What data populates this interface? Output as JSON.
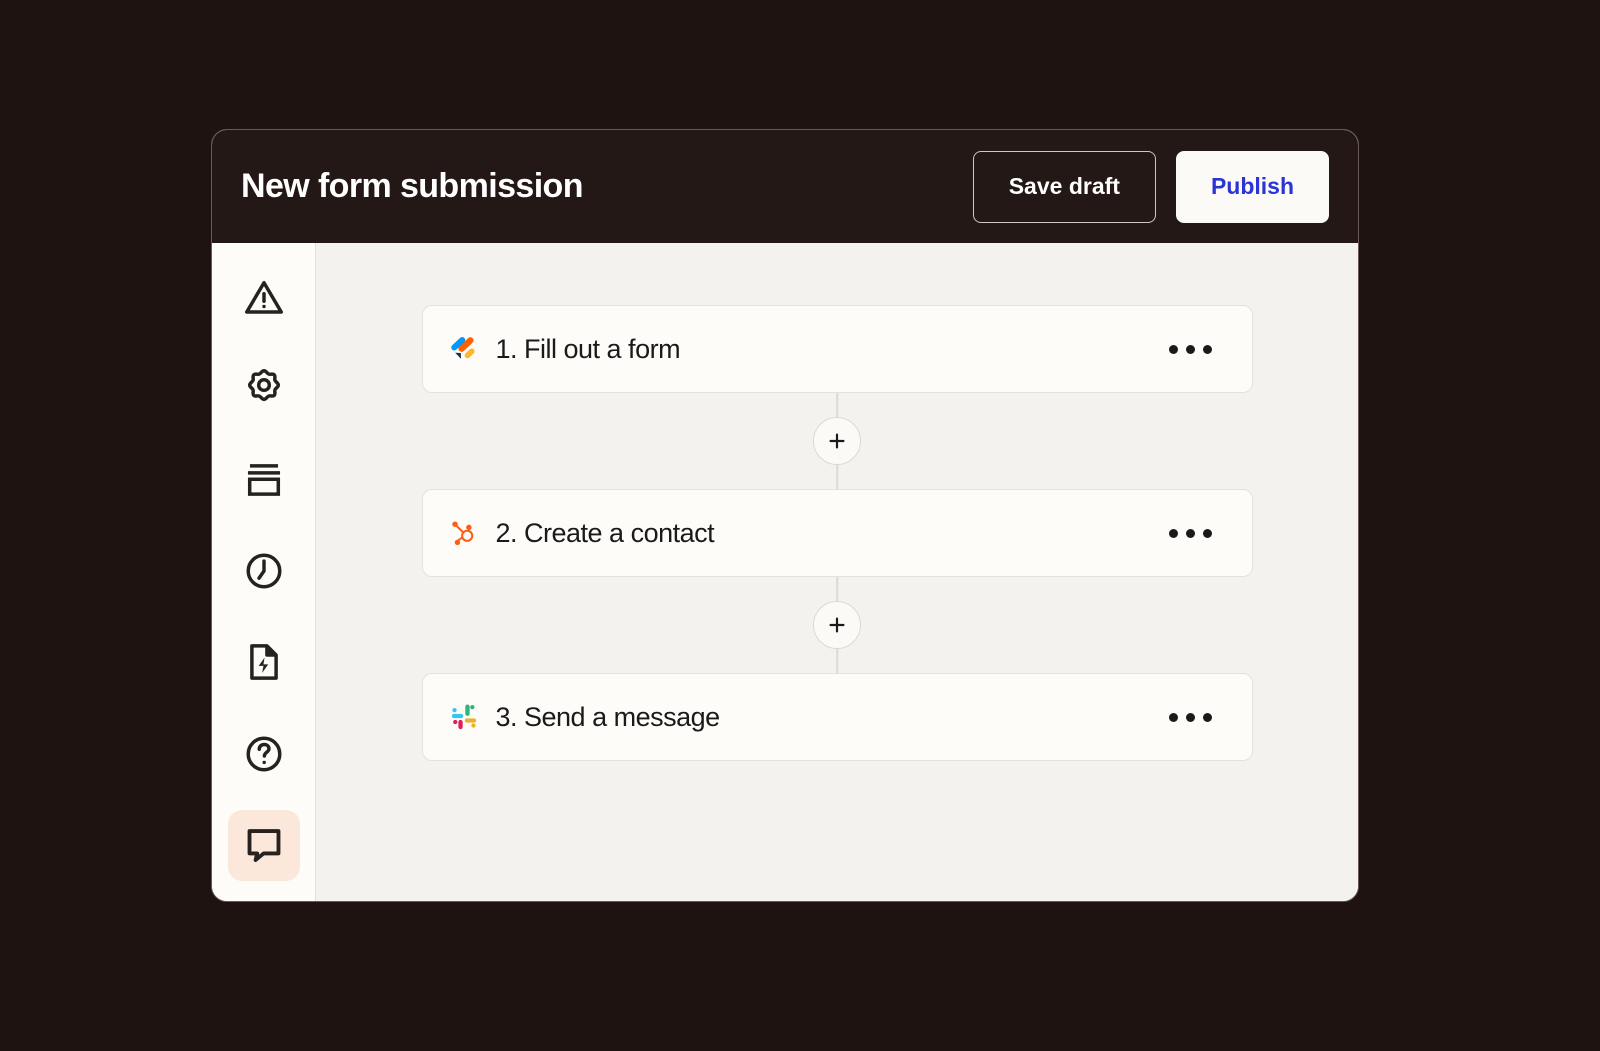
{
  "window": {
    "title": "New form submission",
    "background_color": "#1E1310",
    "header_color": "#231815",
    "canvas_color": "#F3F2EF",
    "sidebar_color": "#FDFCF8"
  },
  "header": {
    "title": "New form submission",
    "buttons": [
      {
        "label": "Save draft",
        "style": "secondary",
        "name": "save-draft-button"
      },
      {
        "label": "Publish",
        "style": "primary",
        "name": "publish-button",
        "text_color": "#2B35D6"
      }
    ]
  },
  "sidebar": {
    "items": [
      {
        "icon": "warning-triangle-icon",
        "active": false
      },
      {
        "icon": "gear-icon",
        "active": false
      },
      {
        "icon": "layers-icon",
        "active": false
      },
      {
        "icon": "clock-icon",
        "active": false
      },
      {
        "icon": "document-lightning-icon",
        "active": false
      },
      {
        "icon": "help-circle-icon",
        "active": false
      },
      {
        "icon": "comment-icon",
        "active": true
      }
    ],
    "active_highlight_color": "#FBE8DA"
  },
  "flow": {
    "steps": [
      {
        "label": "1. Fill out a form",
        "app": "jotform",
        "logo_colors": [
          "#0099FF",
          "#FF6100",
          "#FFB629",
          "#1A2E5A"
        ],
        "menu": "more-options-icon"
      },
      {
        "label": "2. Create a contact",
        "app": "hubspot",
        "logo_colors": [
          "#FF5C16"
        ],
        "menu": "more-options-icon"
      },
      {
        "label": "3. Send a message",
        "app": "slack",
        "logo_colors": [
          "#36C5F0",
          "#2EB67D",
          "#ECB22E",
          "#E01E5A"
        ],
        "menu": "more-options-icon"
      }
    ],
    "add_buttons": [
      {
        "label": "+",
        "name": "add-step-button-1"
      },
      {
        "label": "+",
        "name": "add-step-button-2"
      }
    ]
  }
}
